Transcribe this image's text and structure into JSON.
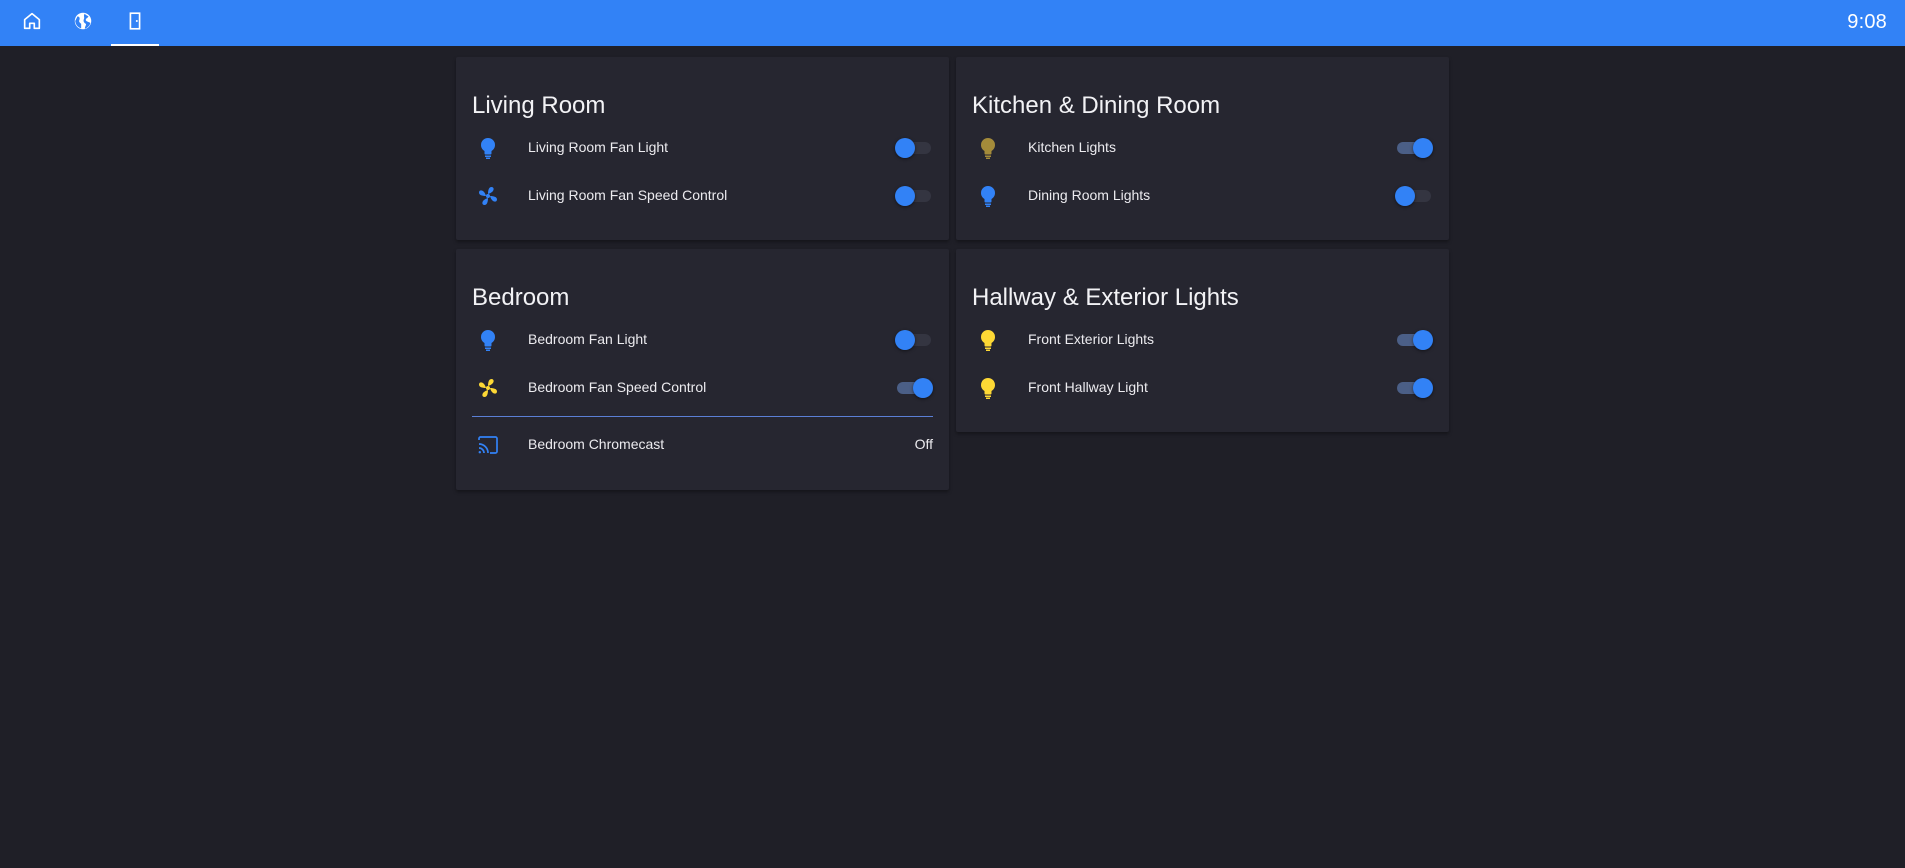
{
  "header": {
    "tabs": [
      {
        "icon": "home-icon",
        "active": false
      },
      {
        "icon": "globe-icon",
        "active": false
      },
      {
        "icon": "door-icon",
        "active": true
      }
    ],
    "clock": "9:08"
  },
  "colors": {
    "accent": "#3282f6",
    "icon_active_yellow": "#fdd835",
    "icon_dim_yellow": "#a48b3a",
    "icon_blue": "#3282f6",
    "background": "#1f1f27",
    "card": "#262630"
  },
  "cards": {
    "living_room": {
      "title": "Living Room",
      "rows": [
        {
          "label": "Living Room Fan Light",
          "icon": "lightbulb-icon",
          "state": "off"
        },
        {
          "label": "Living Room Fan Speed Control",
          "icon": "fan-icon",
          "state": "off"
        }
      ]
    },
    "kitchen": {
      "title": "Kitchen & Dining Room",
      "rows": [
        {
          "label": "Kitchen Lights",
          "icon": "lightbulb-icon",
          "state": "on"
        },
        {
          "label": "Dining Room Lights",
          "icon": "lightbulb-icon",
          "state": "off"
        }
      ]
    },
    "bedroom": {
      "title": "Bedroom",
      "rows": [
        {
          "label": "Bedroom Fan Light",
          "icon": "lightbulb-icon",
          "state": "off"
        },
        {
          "label": "Bedroom Fan Speed Control",
          "icon": "fan-icon",
          "state": "on"
        },
        {
          "label": "Bedroom Chromecast",
          "icon": "cast-icon",
          "state_text": "Off"
        }
      ]
    },
    "hallway": {
      "title": "Hallway & Exterior Lights",
      "rows": [
        {
          "label": "Front Exterior Lights",
          "icon": "lightbulb-icon",
          "state": "on"
        },
        {
          "label": "Front Hallway Light",
          "icon": "lightbulb-icon",
          "state": "on"
        }
      ]
    }
  }
}
